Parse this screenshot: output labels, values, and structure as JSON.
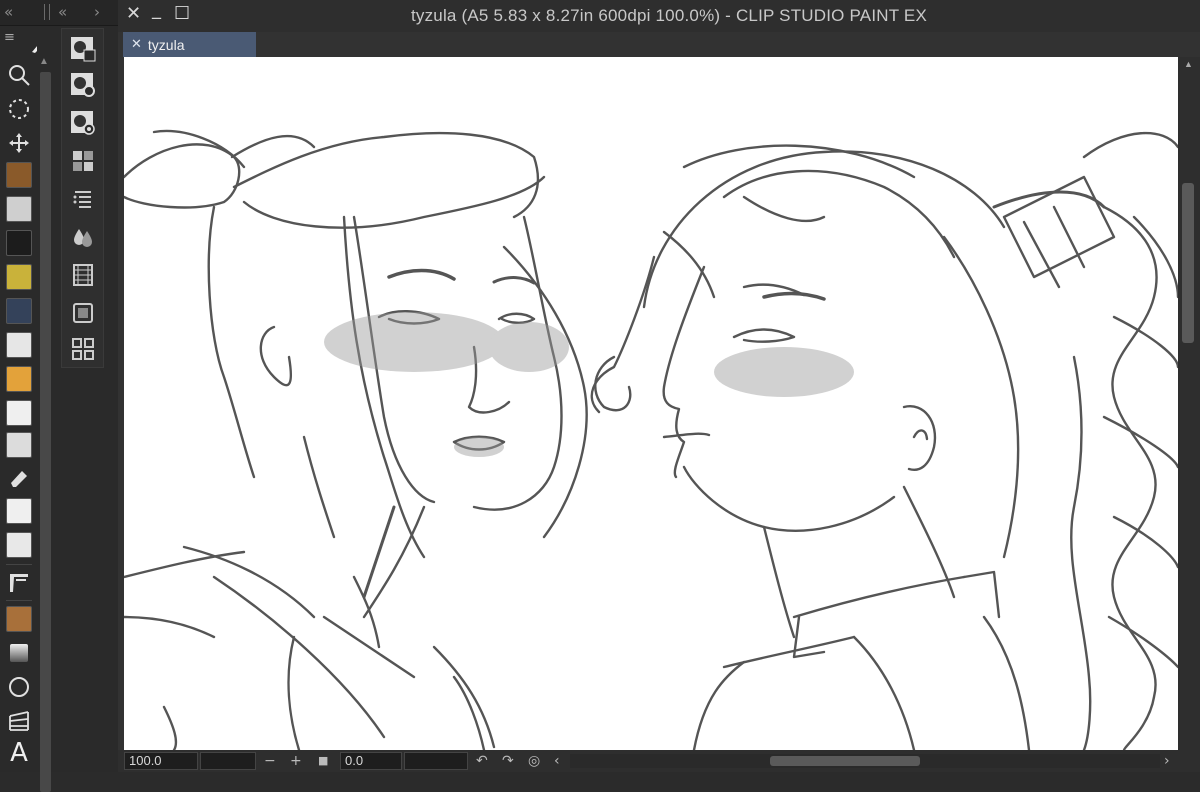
{
  "window": {
    "title": "tyzula (A5 5.83 x 8.27in 600dpi 100.0%)  - CLIP STUDIO PAINT EX",
    "close_glyph": "✕",
    "minimize_glyph": "_",
    "maximize_glyph": "☐"
  },
  "panel_controls": {
    "collapse_left": "«",
    "collapse_left_2": "«",
    "expand_right": "›"
  },
  "tab": {
    "label": "tyzula",
    "close_glyph": "✕"
  },
  "toolbar": {
    "menu_glyph": "≡",
    "text_tool_glyph": "A",
    "tools": [
      "zoom-icon",
      "lasso-select-icon",
      "move-icon",
      "char-1-icon",
      "char-2-icon",
      "char-3-icon",
      "char-4-icon",
      "char-5-icon",
      "char-6-icon",
      "char-7-icon",
      "char-8-icon",
      "char-9-icon",
      "marker-icon",
      "char-10-icon",
      "char-11-icon",
      "ruler-icon",
      "char-12-icon",
      "gradient-icon",
      "circle-icon",
      "perspective-icon",
      "text-icon"
    ]
  },
  "status": {
    "zoom_value": "100.0",
    "minus_glyph": "−",
    "plus_glyph": "+",
    "stop_glyph": "■",
    "rotation_value": "0.0",
    "undo_glyph": "↶",
    "redo_glyph": "↷",
    "reset_glyph": "◎",
    "scroll_left_glyph": "‹",
    "scroll_right_glyph": "›"
  },
  "colors": {
    "tab_active": "#4a5a74",
    "canvas": "#ffffff",
    "ui_dark": "#2e2e2e"
  }
}
